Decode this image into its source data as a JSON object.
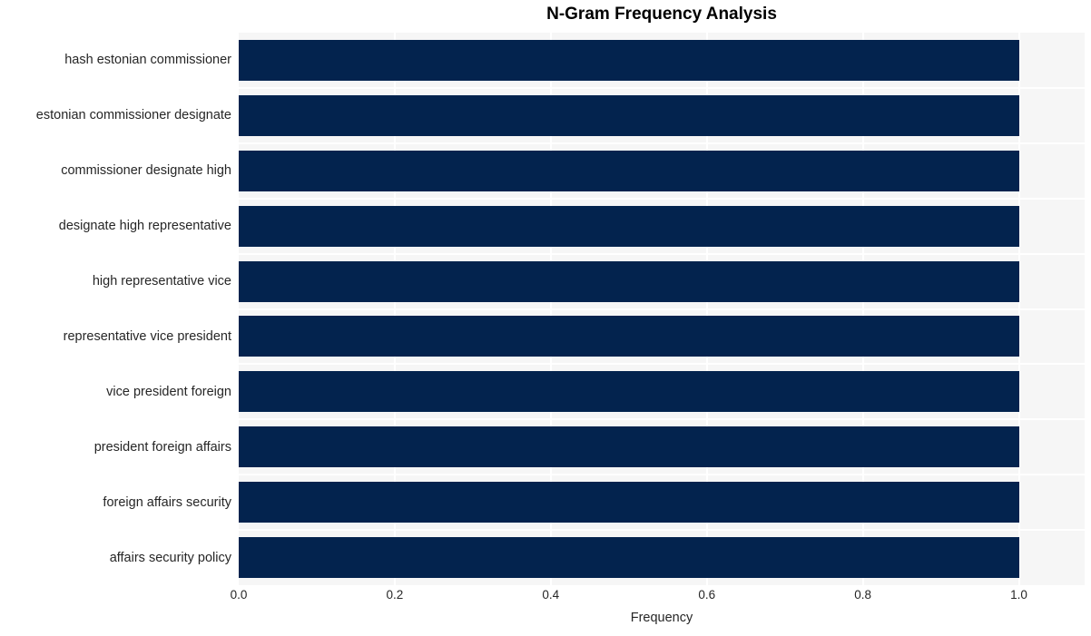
{
  "chart_data": {
    "type": "bar",
    "orientation": "horizontal",
    "title": "N-Gram Frequency Analysis",
    "xlabel": "Frequency",
    "ylabel": "",
    "categories": [
      "hash estonian commissioner",
      "estonian commissioner designate",
      "commissioner designate high",
      "designate high representative",
      "high representative vice",
      "representative vice president",
      "vice president foreign",
      "president foreign affairs",
      "foreign affairs security",
      "affairs security policy"
    ],
    "values": [
      1.0,
      1.0,
      1.0,
      1.0,
      1.0,
      1.0,
      1.0,
      1.0,
      1.0,
      1.0
    ],
    "xlim": [
      0.0,
      1.0843
    ],
    "xticks": [
      0.0,
      0.2,
      0.4,
      0.6,
      0.8,
      1.0
    ],
    "xtick_labels": [
      "0.0",
      "0.2",
      "0.4",
      "0.6",
      "0.8",
      "1.0"
    ],
    "grid": true,
    "legend": null,
    "bar_color": "#03234e",
    "plot_background": "#f6f6f6",
    "figure_background": "#ffffff",
    "gridline_color": "#ffffff",
    "text_color": "#262626",
    "title_color": "#000000"
  }
}
